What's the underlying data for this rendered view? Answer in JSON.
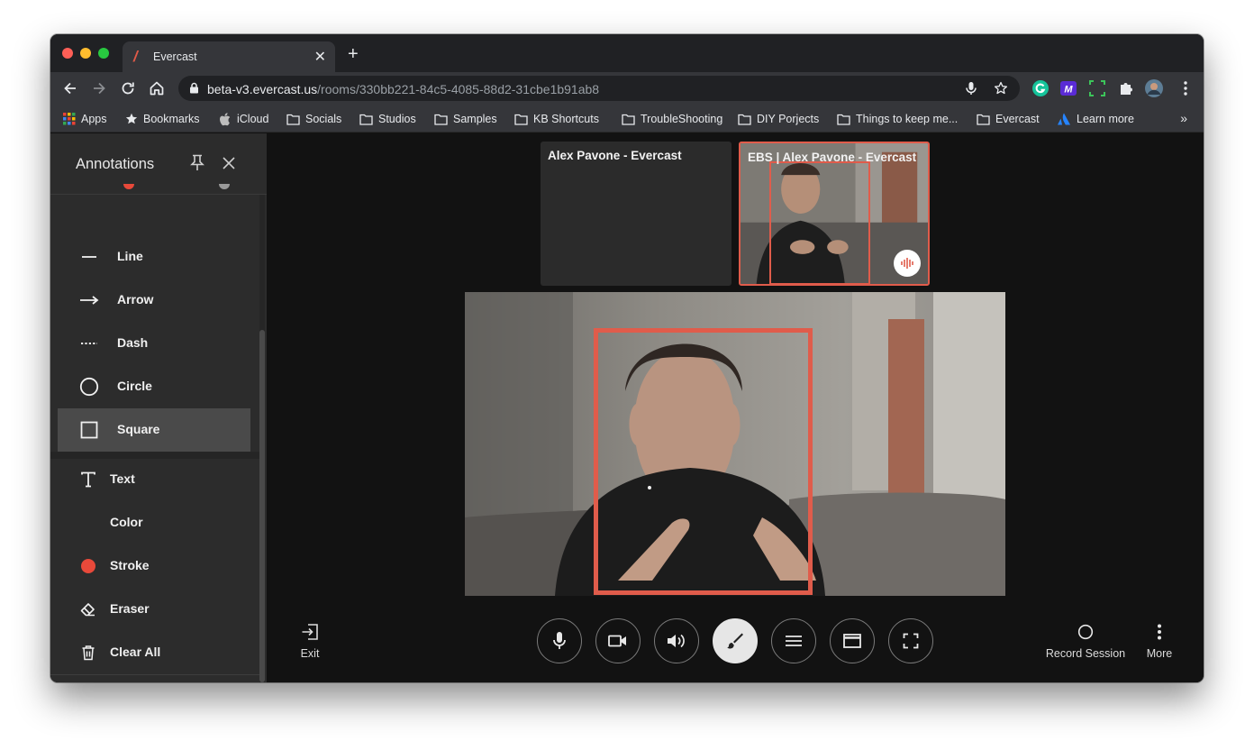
{
  "browser": {
    "tab_title": "Evercast",
    "url_host": "beta-v3.evercast.us",
    "url_path": "/rooms/330bb221-84c5-4085-88d2-31cbe1b91ab8",
    "bookmarks": [
      "Apps",
      "Bookmarks",
      "iCloud",
      "Socials",
      "Studios",
      "Samples",
      "KB Shortcuts",
      "TroubleShooting",
      "DIY Porjects",
      "Things to keep me...",
      "Evercast",
      "Learn more"
    ],
    "bookmarks_overflow": "»"
  },
  "sidebar": {
    "title": "Annotations",
    "shapes": [
      "Line",
      "Arrow",
      "Dash",
      "Circle",
      "Square"
    ],
    "active_shape": "Square",
    "tools": [
      "Text",
      "Color",
      "Stroke",
      "Eraser",
      "Clear All"
    ],
    "stroke_color": "#e8493a"
  },
  "stage": {
    "thumbnails": [
      {
        "label": "Alex Pavone - Evercast"
      },
      {
        "label": "EBS | Alex Pavone - Evercast"
      }
    ],
    "annotation_color": "#e05c4b"
  },
  "controls": {
    "exit_label": "Exit",
    "record_label": "Record Session",
    "more_label": "More",
    "active_control": "annotate"
  }
}
